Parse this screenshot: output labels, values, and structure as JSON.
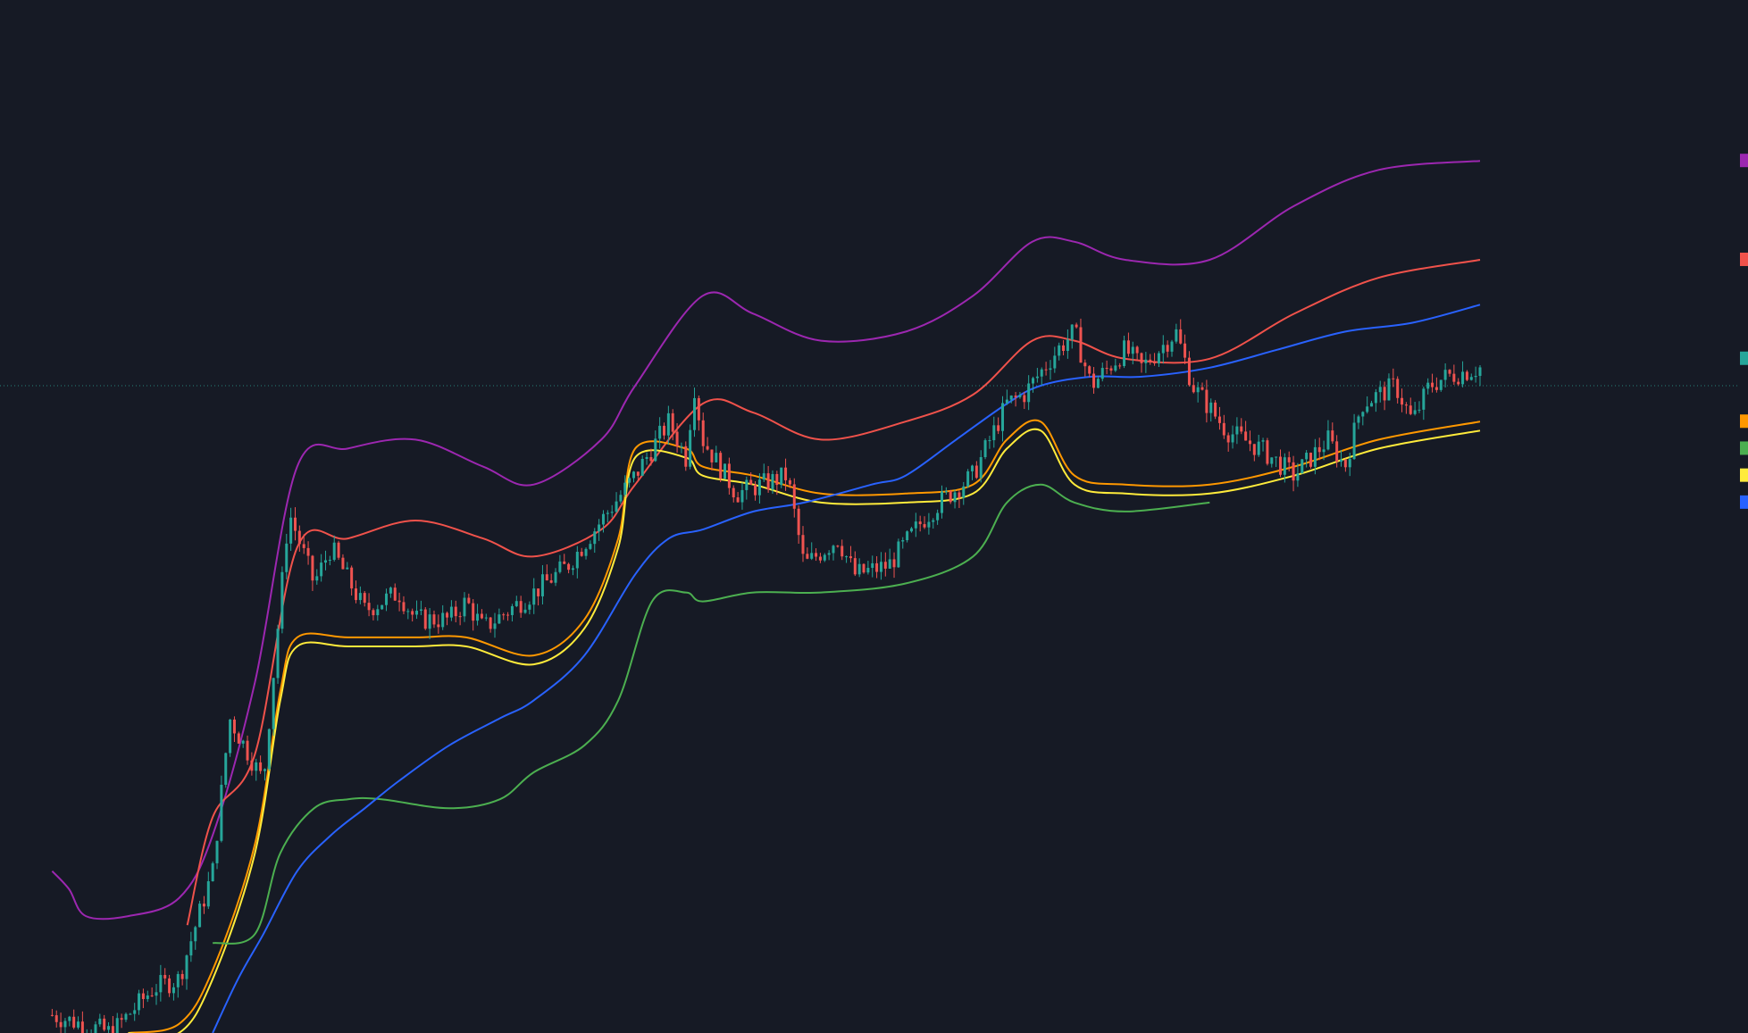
{
  "chart_data": {
    "type": "line",
    "title": "",
    "xlabel": "",
    "ylabel": "",
    "x_range": [
      0,
      1
    ],
    "y_range": [
      0,
      1
    ],
    "grid": false,
    "crosshair_y": 0.72,
    "series": [
      {
        "key": "band-purple",
        "color": "#9c27b0",
        "x": [
          0.015,
          0.025,
          0.035,
          0.06,
          0.09,
          0.11,
          0.135,
          0.16,
          0.19,
          0.23,
          0.27,
          0.3,
          0.34,
          0.36,
          0.4,
          0.43,
          0.47,
          0.52,
          0.56,
          0.595,
          0.62,
          0.65,
          0.7,
          0.75,
          0.8,
          0.86
        ],
        "y": [
          0.18,
          0.16,
          0.13,
          0.13,
          0.15,
          0.22,
          0.39,
          0.63,
          0.65,
          0.66,
          0.63,
          0.61,
          0.66,
          0.72,
          0.82,
          0.8,
          0.77,
          0.78,
          0.82,
          0.88,
          0.88,
          0.86,
          0.86,
          0.92,
          0.96,
          0.97
        ]
      },
      {
        "key": "band-red",
        "color": "#f0524b",
        "x": [
          0.095,
          0.11,
          0.135,
          0.16,
          0.19,
          0.23,
          0.27,
          0.3,
          0.34,
          0.36,
          0.4,
          0.43,
          0.47,
          0.52,
          0.56,
          0.595,
          0.62,
          0.65,
          0.7,
          0.75,
          0.8,
          0.86
        ],
        "y": [
          0.12,
          0.24,
          0.31,
          0.54,
          0.55,
          0.57,
          0.55,
          0.53,
          0.56,
          0.61,
          0.7,
          0.69,
          0.66,
          0.68,
          0.71,
          0.77,
          0.77,
          0.75,
          0.75,
          0.8,
          0.84,
          0.86
        ]
      },
      {
        "key": "band-orange",
        "color": "#ff9800",
        "x": [
          0.06,
          0.09,
          0.11,
          0.135,
          0.15,
          0.16,
          0.19,
          0.23,
          0.26,
          0.3,
          0.33,
          0.35,
          0.36,
          0.39,
          0.4,
          0.43,
          0.47,
          0.52,
          0.56,
          0.58,
          0.6,
          0.62,
          0.65,
          0.7,
          0.75,
          0.8,
          0.86
        ],
        "y": [
          0.0,
          0.01,
          0.07,
          0.21,
          0.38,
          0.44,
          0.44,
          0.44,
          0.44,
          0.42,
          0.46,
          0.55,
          0.65,
          0.65,
          0.63,
          0.62,
          0.6,
          0.6,
          0.61,
          0.66,
          0.68,
          0.62,
          0.61,
          0.61,
          0.63,
          0.66,
          0.68
        ]
      },
      {
        "key": "band-yellow",
        "color": "#ffeb3b",
        "x": [
          0.06,
          0.09,
          0.11,
          0.135,
          0.15,
          0.16,
          0.19,
          0.23,
          0.26,
          0.3,
          0.33,
          0.35,
          0.36,
          0.39,
          0.4,
          0.43,
          0.47,
          0.52,
          0.56,
          0.58,
          0.6,
          0.62,
          0.65,
          0.7,
          0.75,
          0.8,
          0.86
        ],
        "y": [
          0.0,
          0.0,
          0.06,
          0.2,
          0.37,
          0.43,
          0.43,
          0.43,
          0.43,
          0.41,
          0.45,
          0.54,
          0.64,
          0.64,
          0.62,
          0.61,
          0.59,
          0.59,
          0.6,
          0.65,
          0.67,
          0.61,
          0.6,
          0.6,
          0.62,
          0.65,
          0.67
        ]
      },
      {
        "key": "band-green",
        "color": "#4caf50",
        "x": [
          0.11,
          0.135,
          0.15,
          0.17,
          0.19,
          0.21,
          0.25,
          0.28,
          0.3,
          0.33,
          0.35,
          0.37,
          0.39,
          0.4,
          0.43,
          0.47,
          0.52,
          0.56,
          0.58,
          0.6,
          0.62,
          0.65,
          0.7
        ],
        "y": [
          0.1,
          0.11,
          0.2,
          0.25,
          0.26,
          0.26,
          0.25,
          0.26,
          0.29,
          0.32,
          0.37,
          0.48,
          0.49,
          0.48,
          0.49,
          0.49,
          0.5,
          0.53,
          0.59,
          0.61,
          0.59,
          0.58,
          0.59
        ]
      },
      {
        "key": "band-blue",
        "color": "#2962ff",
        "x": [
          0.11,
          0.125,
          0.14,
          0.16,
          0.18,
          0.2,
          0.22,
          0.25,
          0.28,
          0.3,
          0.33,
          0.36,
          0.38,
          0.4,
          0.43,
          0.46,
          0.5,
          0.52,
          0.55,
          0.58,
          0.6,
          0.63,
          0.66,
          0.7,
          0.74,
          0.78,
          0.82,
          0.86
        ],
        "y": [
          0.0,
          0.06,
          0.11,
          0.18,
          0.22,
          0.25,
          0.28,
          0.32,
          0.35,
          0.37,
          0.42,
          0.51,
          0.55,
          0.56,
          0.58,
          0.59,
          0.61,
          0.62,
          0.66,
          0.7,
          0.72,
          0.73,
          0.73,
          0.74,
          0.76,
          0.78,
          0.79,
          0.81
        ]
      }
    ],
    "candles": {
      "up_color": "#26a69a",
      "down_color": "#ef5350",
      "path_x": [
        0.015,
        0.05,
        0.075,
        0.09,
        0.11,
        0.12,
        0.14,
        0.15,
        0.155,
        0.17,
        0.18,
        0.2,
        0.22,
        0.23,
        0.25,
        0.26,
        0.27,
        0.3,
        0.32,
        0.34,
        0.36,
        0.38,
        0.39,
        0.395,
        0.4,
        0.42,
        0.45,
        0.46,
        0.48,
        0.49,
        0.51,
        0.53,
        0.54,
        0.56,
        0.57,
        0.58,
        0.59,
        0.61,
        0.62,
        0.63,
        0.65,
        0.66,
        0.68,
        0.69,
        0.71,
        0.73,
        0.75,
        0.76,
        0.77,
        0.78,
        0.79,
        0.81,
        0.82,
        0.83,
        0.84,
        0.86
      ],
      "path_y": [
        0.02,
        0.0,
        0.05,
        0.06,
        0.18,
        0.35,
        0.28,
        0.48,
        0.58,
        0.5,
        0.54,
        0.47,
        0.49,
        0.46,
        0.46,
        0.48,
        0.45,
        0.49,
        0.52,
        0.57,
        0.62,
        0.68,
        0.64,
        0.72,
        0.66,
        0.6,
        0.62,
        0.52,
        0.55,
        0.51,
        0.52,
        0.57,
        0.59,
        0.62,
        0.66,
        0.7,
        0.71,
        0.76,
        0.78,
        0.72,
        0.76,
        0.74,
        0.78,
        0.72,
        0.67,
        0.65,
        0.62,
        0.64,
        0.66,
        0.63,
        0.7,
        0.72,
        0.68,
        0.72,
        0.73,
        0.74
      ]
    },
    "legend_swatches": [
      {
        "color": "#9c27b0",
        "y": 0.97
      },
      {
        "color": "#f0524b",
        "y": 0.86
      },
      {
        "color": "#26a69a",
        "y": 0.75
      },
      {
        "color": "#ff9800",
        "y": 0.68
      },
      {
        "color": "#4caf50",
        "y": 0.65
      },
      {
        "color": "#ffeb3b",
        "y": 0.62
      },
      {
        "color": "#2962ff",
        "y": 0.59
      }
    ]
  }
}
